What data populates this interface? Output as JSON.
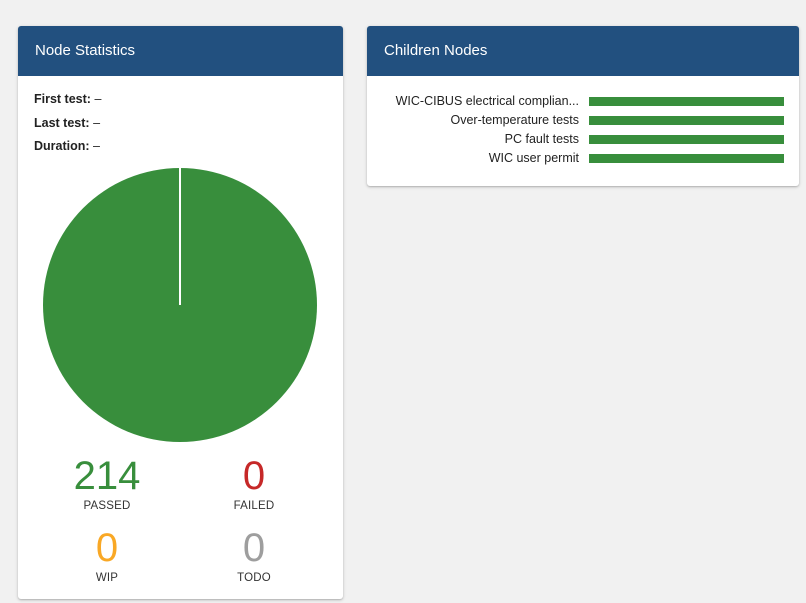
{
  "colors": {
    "header_bg": "#22507f",
    "passed": "#388e3c",
    "failed": "#c62828",
    "wip": "#f9a825",
    "todo": "#9e9e9e"
  },
  "node_statistics": {
    "title": "Node Statistics",
    "first_test_label": "First test:",
    "first_test_value": "–",
    "last_test_label": "Last test:",
    "last_test_value": "–",
    "duration_label": "Duration:",
    "duration_value": "–",
    "pie": {
      "passed": 214,
      "failed": 0,
      "wip": 0,
      "todo": 0
    },
    "stats": {
      "passed": {
        "value": "214",
        "label": "PASSED"
      },
      "failed": {
        "value": "0",
        "label": "FAILED"
      },
      "wip": {
        "value": "0",
        "label": "WIP"
      },
      "todo": {
        "value": "0",
        "label": "TODO"
      }
    }
  },
  "children_nodes": {
    "title": "Children Nodes",
    "items": [
      {
        "label": "WIC-CIBUS electrical complian...",
        "passed_fraction": 1.0
      },
      {
        "label": "Over-temperature tests",
        "passed_fraction": 1.0
      },
      {
        "label": "PC fault tests",
        "passed_fraction": 1.0
      },
      {
        "label": "WIC user permit",
        "passed_fraction": 1.0
      }
    ]
  }
}
